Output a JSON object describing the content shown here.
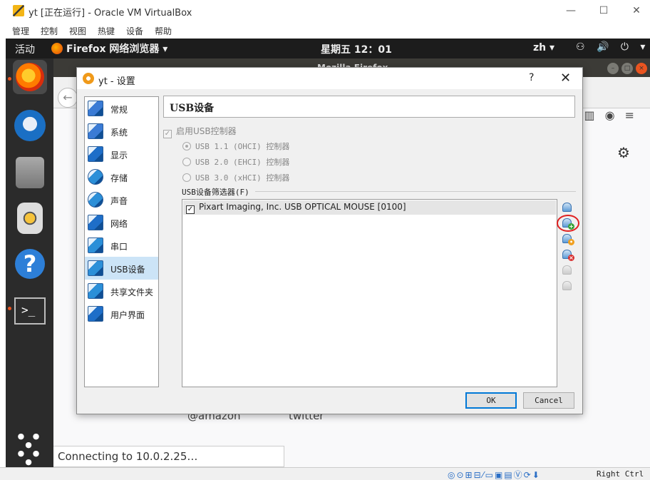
{
  "host": {
    "title": "yt [正在运行] - Oracle VM VirtualBox",
    "menu": [
      "管理",
      "控制",
      "视图",
      "热键",
      "设备",
      "帮助"
    ]
  },
  "gnome": {
    "activities": "活动",
    "app": "Firefox 网络浏览器 ▾",
    "clock": "星期五 12：01",
    "lang": "zh ▾",
    "sys": "⚇ 🔊 ⏻ ▾"
  },
  "firefox": {
    "title": "Mozilla Firefox",
    "shortcut1": "@amazon",
    "shortcut2": "twitter",
    "status": "Connecting to 10.0.2.25…"
  },
  "dialog": {
    "title": "yt - 设置",
    "help": "?",
    "close": "✕",
    "categories": [
      {
        "label": "常规",
        "icon": "general-icon",
        "color": "#3a7bd5"
      },
      {
        "label": "系统",
        "icon": "system-icon",
        "color": "#3a7bd5"
      },
      {
        "label": "显示",
        "icon": "display-icon",
        "color": "#1e6ec8"
      },
      {
        "label": "存储",
        "icon": "storage-icon",
        "color": "#2b8fd8"
      },
      {
        "label": "声音",
        "icon": "audio-icon",
        "color": "#2b8fd8"
      },
      {
        "label": "网络",
        "icon": "network-icon",
        "color": "#1e6ec8"
      },
      {
        "label": "串口",
        "icon": "serial-icon",
        "color": "#2b8fd8"
      },
      {
        "label": "USB设备",
        "icon": "usb-icon",
        "color": "#2b8fd8"
      },
      {
        "label": "共享文件夹",
        "icon": "shared-folder-icon",
        "color": "#2b8fd8"
      },
      {
        "label": "用户界面",
        "icon": "user-interface-icon",
        "color": "#1e6ec8"
      }
    ],
    "selected_category": 7,
    "page_title": "USB设备",
    "enable_usb": "启用USB控制器",
    "usb_options": [
      "USB 1.1 (OHCI) 控制器",
      "USB 2.0 (EHCI) 控制器",
      "USB 3.0 (xHCI) 控制器"
    ],
    "filters_label": "USB设备筛选器(F)",
    "filters": [
      {
        "label": "Pixart Imaging, Inc. USB OPTICAL MOUSE [0100]",
        "checked": true
      }
    ],
    "ok": "OK",
    "cancel": "Cancel"
  },
  "vb_status": {
    "icons": "◎⊙⊞⊟⁄▭▣▤Ⓥ⟳⬇",
    "hostkey": "Right Ctrl"
  }
}
